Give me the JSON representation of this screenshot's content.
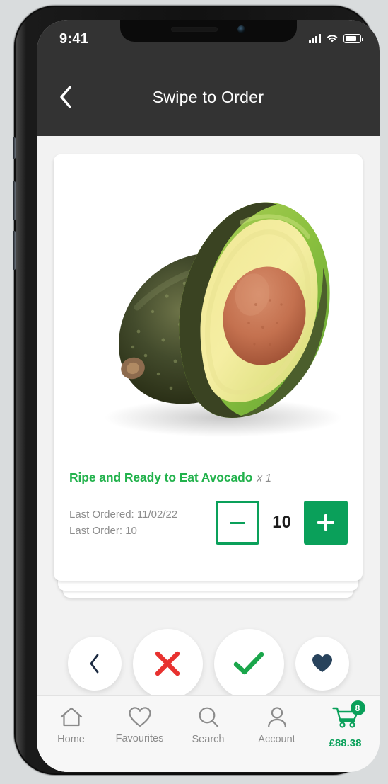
{
  "status_bar": {
    "time": "9:41",
    "cellular_icon": "signal-bars-icon",
    "wifi_icon": "wifi-icon",
    "battery_icon": "battery-icon"
  },
  "header": {
    "title": "Swipe to Order",
    "back_icon": "chevron-left-icon"
  },
  "card": {
    "product_image_alt": "avocado-product-image",
    "title": "Ripe and Ready to Eat Avocado",
    "quantity_suffix": "x 1",
    "meta": [
      "Last Ordered: 11/02/22",
      "Last Order: 10"
    ],
    "stepper": {
      "decrease_icon": "minus-icon",
      "increase_icon": "plus-icon",
      "quantity": "10"
    }
  },
  "actions": [
    {
      "name": "undo-button",
      "icon": "chevron-left-icon",
      "color": "#1b2a41",
      "size": "small"
    },
    {
      "name": "reject-button",
      "icon": "close-x-icon",
      "color": "#e8312f",
      "size": "large"
    },
    {
      "name": "accept-button",
      "icon": "check-icon",
      "color": "#1aa64b",
      "size": "large"
    },
    {
      "name": "favourite-button",
      "icon": "heart-icon",
      "color": "#28435c",
      "size": "small"
    }
  ],
  "bottom_nav": {
    "items": [
      {
        "label": "Home",
        "icon": "home-icon"
      },
      {
        "label": "Favourites",
        "icon": "heart-outline-icon"
      },
      {
        "label": "Search",
        "icon": "search-icon"
      },
      {
        "label": "Account",
        "icon": "person-icon"
      },
      {
        "label": "£88.38",
        "icon": "cart-icon",
        "badge": "8"
      }
    ]
  },
  "colors": {
    "brand_green": "#0aa05a",
    "title_green": "#22b24c",
    "header_dark": "#333333",
    "reject_red": "#e8312f",
    "accept_green": "#1aa64b",
    "navy": "#1b2a41"
  }
}
